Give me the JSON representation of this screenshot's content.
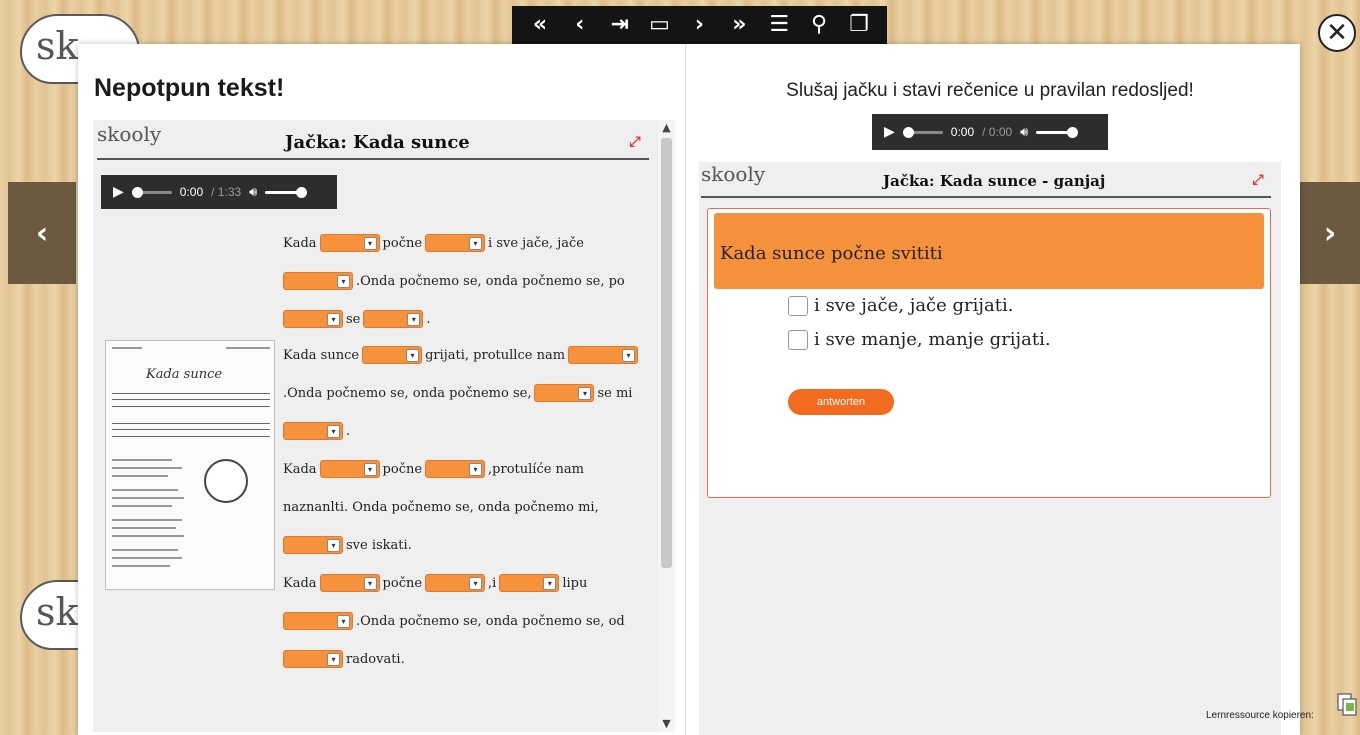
{
  "app": {
    "logo_text": "sk",
    "close_icon": "close-icon"
  },
  "toolbar": {
    "buttons": [
      {
        "icon": "double-left-icon",
        "glyph": "«"
      },
      {
        "icon": "chevron-left-icon",
        "glyph": "‹"
      },
      {
        "icon": "last-page-icon",
        "glyph": "⇥"
      },
      {
        "icon": "bookmark-icon",
        "glyph": "▭"
      },
      {
        "icon": "chevron-right-icon",
        "glyph": "›"
      },
      {
        "icon": "double-right-icon",
        "glyph": "»"
      },
      {
        "icon": "list-icon",
        "glyph": "☰"
      },
      {
        "icon": "search-icon",
        "glyph": "⚲"
      },
      {
        "icon": "windows-icon",
        "glyph": "❐"
      }
    ]
  },
  "nav": {
    "prev_glyph": "‹",
    "next_glyph": "›"
  },
  "left": {
    "title": "Nepotpun tekst!",
    "skooly_logo": "skooly",
    "activity_title": "Jačka: Kada sunce",
    "audio": {
      "time_current": "0:00",
      "time_total": "/ 1:33"
    },
    "sheet_title": "Kada sunce",
    "lyrics": {
      "r1_a": "Kada",
      "r1_b": "počne",
      "r1_c": "i sve jače, jače",
      "r2_a": ".Onda počnemo se, onda počnemo se, po",
      "r3_a": "se",
      "r3_b": ".",
      "r4_a": "Kada sunce",
      "r4_b": "grijati, protullce nam",
      "r5_a": ".Onda počnemo se, onda počnemo se,",
      "r5_b": "se mi",
      "r6_a": ".",
      "r7_a": "Kada",
      "r7_b": "počne",
      "r7_c": ",protulíće nam",
      "r8_a": "naznanlti. Onda počnemo se, onda počnemo mi,",
      "r9_a": "sve iskati.",
      "r10_a": "Kada",
      "r10_b": "počne",
      "r10_c": ",i",
      "r10_d": "lipu",
      "r11_a": ".Onda počnemo se, onda počnemo se, od",
      "r12_a": "radovati."
    }
  },
  "right": {
    "instruction": "Slušaj jačku i stavi rečenice u pravilan redosljed!",
    "audio": {
      "time_current": "0:00",
      "time_total": "/ 0:00"
    },
    "skooly_logo": "skooly",
    "activity_title": "Jačka: Kada sunce - ganjaj",
    "header_text": "Kada sunce počne svititi",
    "options": [
      "i sve jače, jače grijati.",
      "i sve manje, manje grijati."
    ],
    "submit_label": "antworten"
  },
  "footer": {
    "copy_label": "Lernressource kopieren:"
  },
  "colors": {
    "accent_orange": "#f7923c",
    "button_orange": "#f26b1e",
    "toolbar_bg": "#141414",
    "side_nav_bg": "#6b5a3f"
  }
}
